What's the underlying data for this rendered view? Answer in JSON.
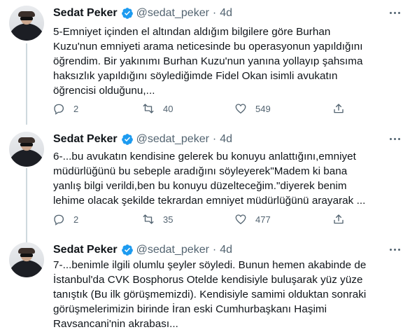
{
  "tweets": [
    {
      "name": "Sedat Peker",
      "handle": "@sedat_peker",
      "separator": "·",
      "time": "4d",
      "text": "5-Emniyet içinden el altından aldığım bilgilere göre Burhan\nKuzu'nun emniyeti arama neticesinde bu operasyonun yapıldığını\nöğrendim. Bir yakınımı Burhan Kuzu'nun yanına yollayıp şahsıma\nhaksızlık yapıldığını söylediğimde Fidel Okan isimli avukatın\nöğrencisi olduğunu,...",
      "replies": "2",
      "retweets": "40",
      "likes": "549"
    },
    {
      "name": "Sedat Peker",
      "handle": "@sedat_peker",
      "separator": "·",
      "time": "4d",
      "text": "6-...bu avukatın kendisine gelerek bu konuyu anlattığını,emniyet\nmüdürlüğünü bu sebeple aradığını söyleyerek\"Madem ki bana\nyanlış bilgi verildi,ben bu konuyu düzelteceğim.\"diyerek benim\nlehime olacak şekilde tekrardan emniyet müdürlüğünü arayarak ...",
      "replies": "2",
      "retweets": "35",
      "likes": "477"
    },
    {
      "name": "Sedat Peker",
      "handle": "@sedat_peker",
      "separator": "·",
      "time": "4d",
      "text": "7-...benimle ilgili olumlu şeyler söyledi. Bunun hemen akabinde de\nİstanbul'da CVK Bosphorus Otelde kendisiyle buluşarak yüz yüze\ntanıştık (Bu ilk görüşmemizdi). Kendisiyle samimi olduktan sonraki\ngörüşmelerimizin birinde İran eski Cumhurbaşkanı Haşimi\nRavsancani'nin akrabası...",
      "replies": "",
      "retweets": "",
      "likes": ""
    }
  ],
  "colors": {
    "verified": "#1d9bf0",
    "text": "#0f1419",
    "muted": "#536471",
    "thread_line": "#cfd9de"
  },
  "icons": [
    "avatar",
    "verified-badge-icon",
    "more-icon",
    "reply-icon",
    "retweet-icon",
    "like-icon",
    "share-icon"
  ]
}
